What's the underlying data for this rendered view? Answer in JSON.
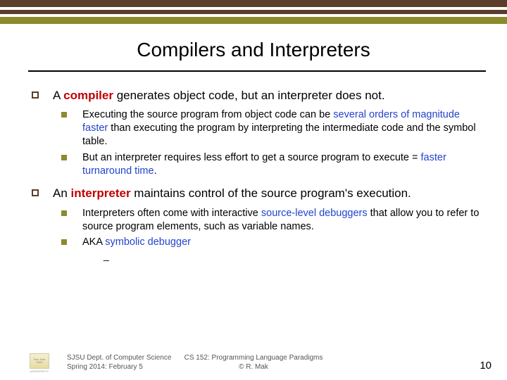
{
  "title": "Compilers and Interpreters",
  "points": [
    {
      "prefix": "A ",
      "term": "compiler",
      "rest": " generates object code, but an interpreter does not.",
      "subs": [
        {
          "p1": "Executing the source program from object code can be ",
          "hl": "several orders of magnitude faster",
          "p2": " than executing the program by interpreting the intermediate code and the symbol table."
        },
        {
          "p1": "But an interpreter requires less effort to get a source program to execute = ",
          "hl": "faster turnaround time",
          "p2": "."
        }
      ]
    },
    {
      "prefix": "An ",
      "term": "interpreter",
      "rest": " maintains control of the source program's execution.",
      "subs": [
        {
          "p1": "Interpreters often come with interactive ",
          "hl": "source-level debuggers",
          "p2": " that allow you to refer to source program elements, such as variable names."
        },
        {
          "p1": "AKA ",
          "hl": "symbolic debugger",
          "p2": ""
        }
      ],
      "trailing_dash": "_"
    }
  ],
  "footer": {
    "left_line1": "SJSU Dept. of Computer Science",
    "left_line2": "Spring 2014: February 5",
    "center_line1": "CS 152: Programming Language Paradigms",
    "center_line2": "© R. Mak",
    "page": "10"
  },
  "logo": {
    "name": "San José State",
    "sub": "UNIVERSITY"
  }
}
